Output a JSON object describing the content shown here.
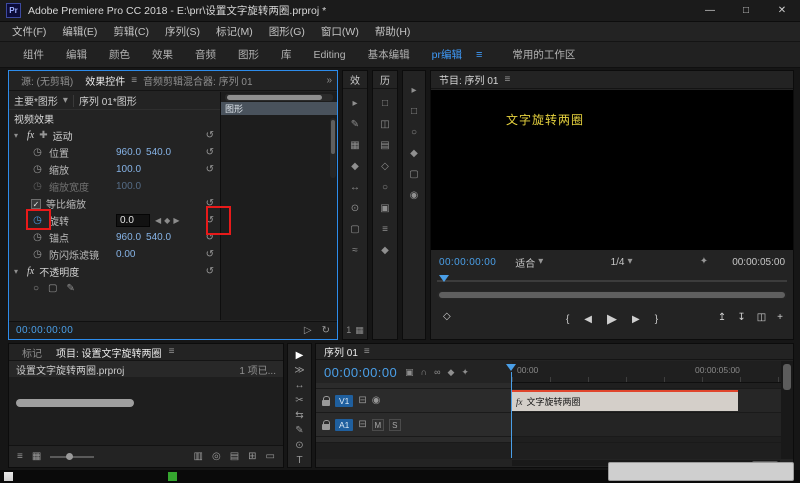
{
  "titlebar": {
    "logo": "Pr",
    "title": "Adobe Premiere Pro CC 2018 - E:\\prr\\设置文字旋转两圈.prproj *",
    "minimize": "—",
    "maximize": "□",
    "close": "✕"
  },
  "menubar": {
    "items": [
      "文件(F)",
      "编辑(E)",
      "剪辑(C)",
      "序列(S)",
      "标记(M)",
      "图形(G)",
      "窗口(W)",
      "帮助(H)"
    ]
  },
  "workspaces": {
    "items": [
      "组件",
      "编辑",
      "颜色",
      "效果",
      "音频",
      "图形",
      "库",
      "Editing",
      "基本编辑"
    ],
    "active": "pr编辑",
    "last": "常用的工作区"
  },
  "effect_controls": {
    "tab_source": "源: (无剪辑)",
    "tab_effect": "效果控件",
    "tab_mixer": "音频剪辑混合器: 序列 01",
    "master_left": "主要*图形",
    "master_right": "序列 01*图形",
    "section_video": "视频效果",
    "fx_label": "fx",
    "fx_motion": "运动",
    "position_label": "位置",
    "position_x": "960.0",
    "position_y": "540.0",
    "scale_label": "缩放",
    "scale_value": "100.0",
    "scale_width_label": "缩放宽度",
    "scale_width_value": "100.0",
    "uniform_label": "等比缩放",
    "rotation_label": "旋转",
    "rotation_value": "0.0",
    "anchor_label": "锚点",
    "anchor_x": "960.0",
    "anchor_y": "540.0",
    "antiflicker_label": "防闪烁滤镜",
    "antiflicker_value": "0.00",
    "fx_opacity": "不透明度",
    "clip_label": "图形",
    "timecode": "00:00:00:00"
  },
  "strips": {
    "a_title": "效",
    "b_title": "历",
    "counter": "1",
    "a_icons": [
      "▸",
      "✎",
      "▦",
      "◆",
      "↔",
      "⊙",
      "▢",
      "≈"
    ],
    "b_icons": [
      "□",
      "◫",
      "▤",
      "◇",
      "○",
      "▣",
      "≡",
      "◆"
    ],
    "c_icons": [
      "▸",
      "□",
      "○",
      "◆",
      "▢",
      "◉"
    ]
  },
  "program": {
    "title": "节目: 序列 01",
    "overlay_text": "文字旋转两圈",
    "timecode": "00:00:00:00",
    "fit": "适合",
    "zoom": "1/4",
    "duration": "00:00:05:00"
  },
  "project": {
    "tab_marker": "标记",
    "tab_project": "项目: 设置文字旋转两圈",
    "filename": "设置文字旋转两圈.prproj",
    "count": "1 项已..."
  },
  "timeline": {
    "tab": "序列 01",
    "timecode": "00:00:00:00",
    "ruler_start": "00:00",
    "ruler_mid": "00:00:05:00",
    "v1": "V1",
    "a1": "A1",
    "mute": "M",
    "solo": "S",
    "clip_fx": "fx",
    "clip_label": "文字旋转两圈"
  },
  "icons": {
    "menu": "≡",
    "overflow": "»",
    "dropdown": "▾",
    "expanded": "▾",
    "collapsed": "▸",
    "stopwatch": "◷",
    "reset": "↺",
    "kf_prev": "◀",
    "kf_add": "◆",
    "kf_next": "▶",
    "motion": "✚",
    "check": "✓",
    "mask_ellipse": "○",
    "mask_rect": "▢",
    "mask_pen": "✎",
    "play_mini": "▷",
    "loop": "↻",
    "marker": "◇",
    "go_in": "{",
    "go_out": "}",
    "step_back": "◀",
    "play": "▶",
    "step_fwd": "▶",
    "lift": "↥",
    "extract": "↧",
    "export_frame": "◫",
    "button_editor": "+",
    "wrench": "✦",
    "nest": "▣",
    "snap": "∩",
    "link": "∞",
    "marker_small": "◆",
    "settings": "✦",
    "list_view": "≡",
    "icon_view": "▦",
    "automate": "▥",
    "find": "◎",
    "new_bin": "▤",
    "new_item": "⊞",
    "trash": "▭",
    "tool_select": "▶",
    "tool_track": "≫",
    "tool_ripple": "↔",
    "tool_razor": "✂",
    "tool_slip": "⇆",
    "tool_pen": "✎",
    "tool_hand": "⊙",
    "tool_type": "T",
    "sync": "⊟",
    "eye": "◉"
  }
}
